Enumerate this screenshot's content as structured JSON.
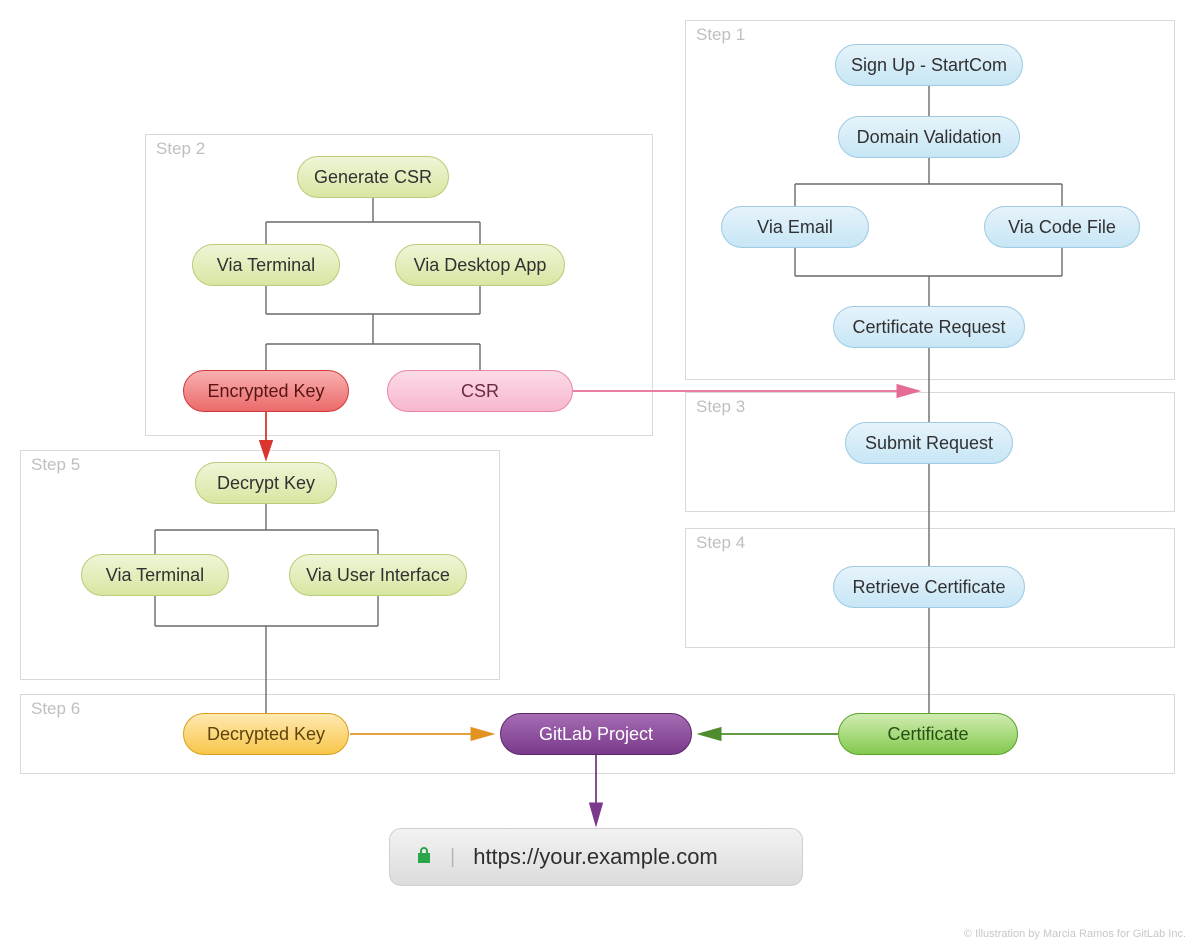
{
  "steps": {
    "s1": "Step 1",
    "s2": "Step 2",
    "s3": "Step 3",
    "s4": "Step 4",
    "s5": "Step 5",
    "s6": "Step 6"
  },
  "nodes": {
    "signup": "Sign Up - StartCom",
    "domain_val": "Domain Validation",
    "via_email": "Via Email",
    "via_code_file": "Via Code File",
    "cert_request": "Certificate Request",
    "submit_req": "Submit Request",
    "retrieve_cert": "Retrieve Certificate",
    "certificate": "Certificate",
    "generate_csr": "Generate CSR",
    "via_terminal": "Via Terminal",
    "via_desktop": "Via Desktop App",
    "encrypted_key": "Encrypted Key",
    "csr": "CSR",
    "decrypt_key": "Decrypt Key",
    "via_terminal2": "Via Terminal",
    "via_ui": "Via User Interface",
    "decrypted_key": "Decrypted Key",
    "gitlab_proj": "GitLab Project"
  },
  "url": "https://your.example.com",
  "credit": "© Illustration by Marcia Ramos for GitLab Inc."
}
